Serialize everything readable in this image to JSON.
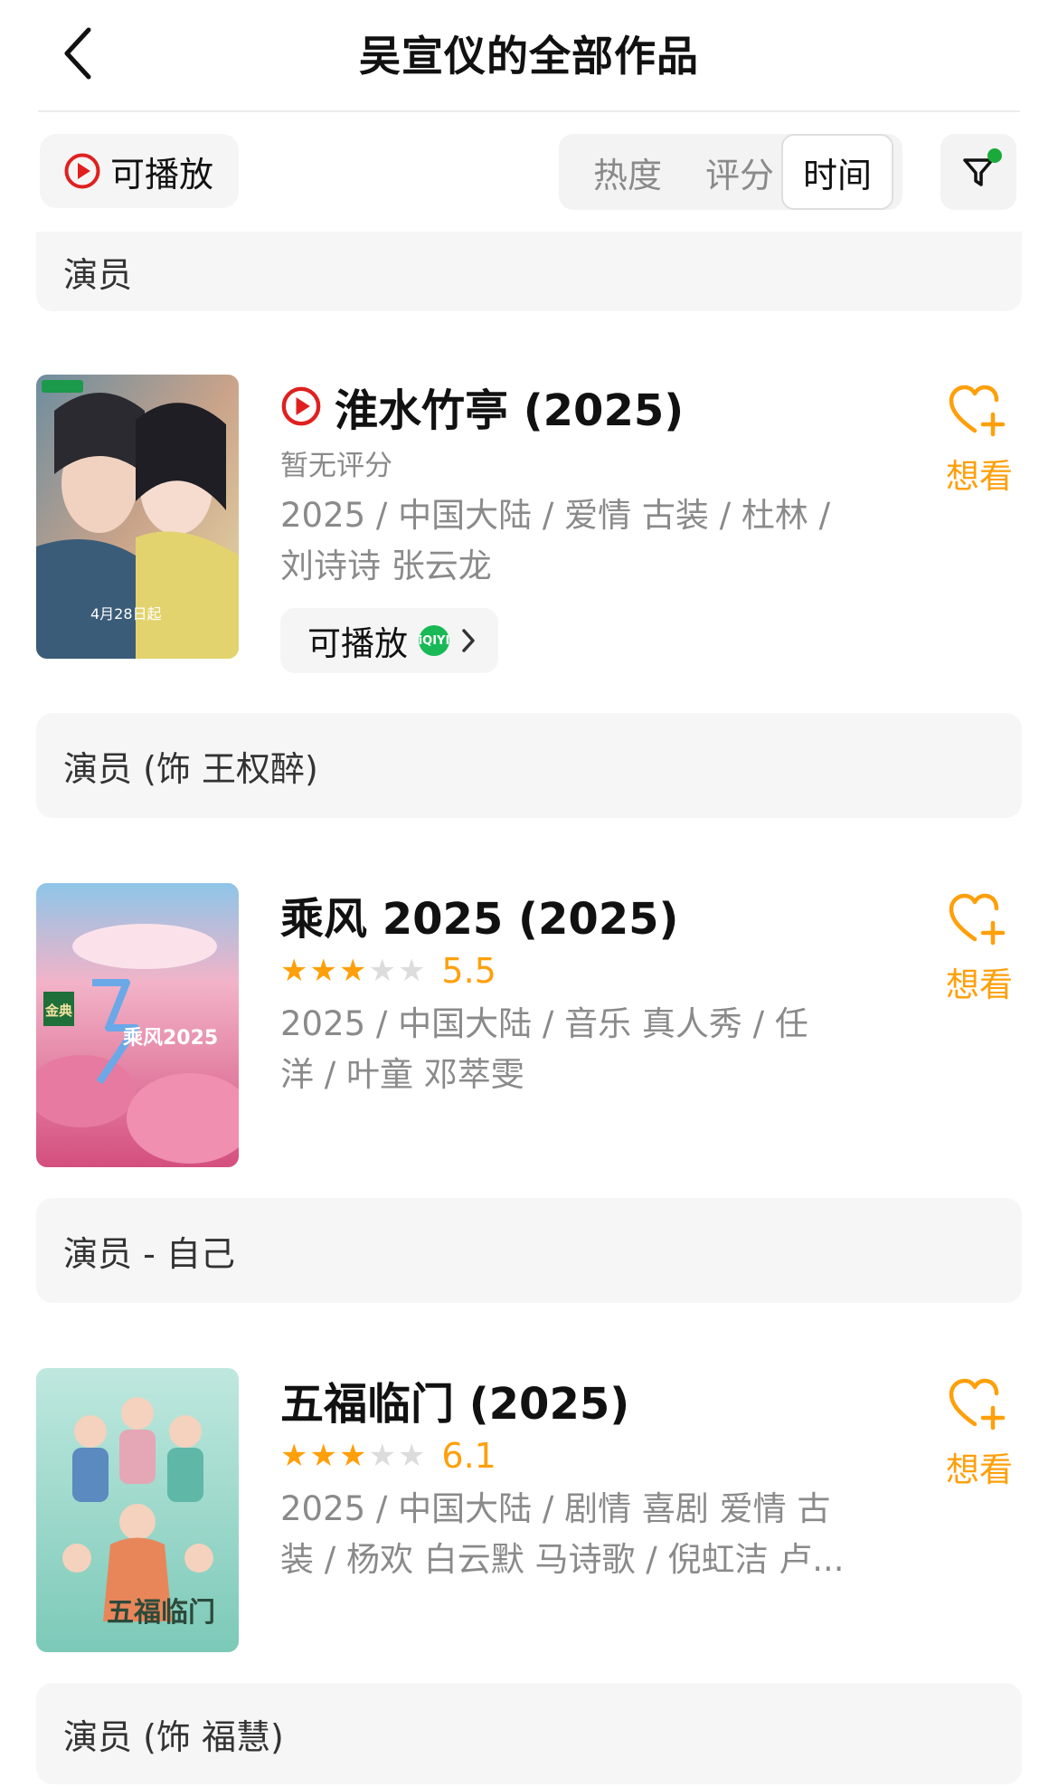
{
  "header": {
    "title": "吴宣仪的全部作品"
  },
  "filters": {
    "playable_label": "可播放",
    "sort_tabs": [
      "热度",
      "评分",
      "时间"
    ],
    "active_sort": "时间"
  },
  "top_role": "演员",
  "works": [
    {
      "title": "淮水竹亭 (2025)",
      "playable_icon": true,
      "rating_text": "暂无评分",
      "meta_line1": "2025 / 中国大陆 / 爱情 古装 / 杜林 /",
      "meta_line2": "刘诗诗 张云龙",
      "play_chip_label": "可播放",
      "platform_badge": "iQIYI",
      "want_label": "想看",
      "role": "演员 (饰 王权醉)",
      "poster_colors": [
        "#c9a38a",
        "#3b5a6e",
        "#e9dca7"
      ]
    },
    {
      "title": "乘风 2025 (2025)",
      "stars": 3,
      "score": "5.5",
      "meta_line1": "2025 / 中国大陆 / 音乐 真人秀 / 任",
      "meta_line2": "洋 / 叶童 邓萃雯",
      "want_label": "想看",
      "role": "演员 - 自己",
      "poster_badge": "金典",
      "poster_logo": "乘风2025",
      "poster_colors": [
        "#f2b3c8",
        "#d44f7e",
        "#8ec5e8"
      ]
    },
    {
      "title": "五福临门 (2025)",
      "stars": 3,
      "score": "6.1",
      "meta_line1": "2025 / 中国大陆 / 剧情 喜剧 爱情 古",
      "meta_line2": "装 / 杨欢 白云默 马诗歌 / 倪虹洁 卢...",
      "want_label": "想看",
      "role": "演员 (饰 福慧)",
      "poster_text": "五福临门",
      "poster_colors": [
        "#bfe8df",
        "#5fb7a8",
        "#f0c7a8"
      ]
    }
  ],
  "colors": {
    "accent": "#ff9f0a",
    "play_red": "#e02020",
    "iqiyi_green": "#19b955"
  }
}
